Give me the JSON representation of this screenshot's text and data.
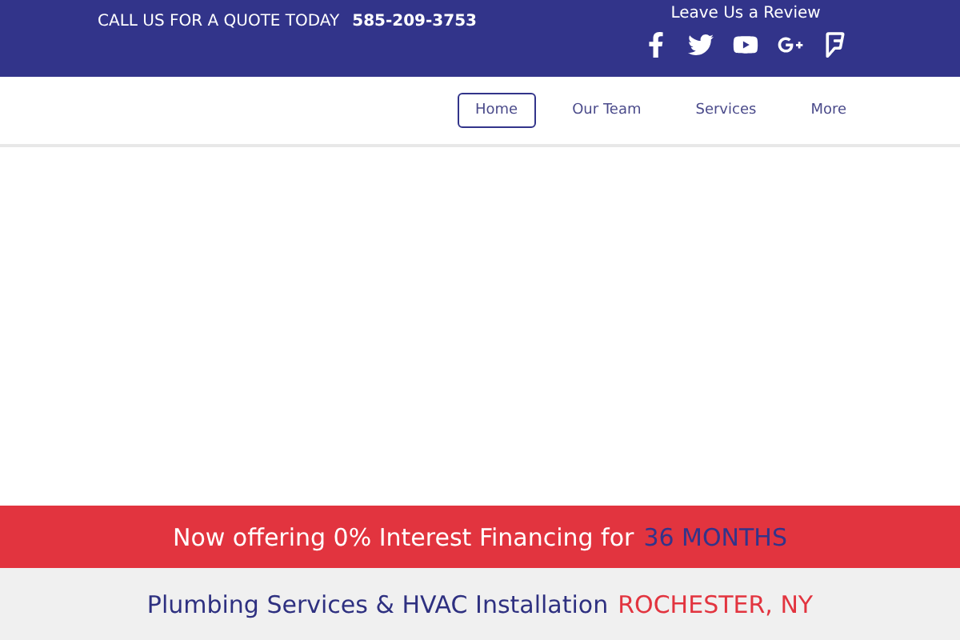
{
  "top_bar": {
    "call_label": "CALL US FOR A QUOTE TODAY",
    "phone": "585-209-3753",
    "review_label": "Leave Us a Review",
    "social": [
      {
        "kind": "facebook"
      },
      {
        "kind": "twitter"
      },
      {
        "kind": "youtube"
      },
      {
        "kind": "googleplus"
      },
      {
        "kind": "foursquare"
      }
    ]
  },
  "nav": [
    {
      "label": "Home",
      "selected": true
    },
    {
      "label": "Our Team",
      "selected": false
    },
    {
      "label": "Services",
      "selected": false
    },
    {
      "label": "More",
      "selected": false
    }
  ],
  "banner": {
    "text": "Now offering 0% Interest Financing for",
    "highlight": "36 MONTHS"
  },
  "tagline": {
    "text": "Plumbing Services & HVAC Installation",
    "location": "ROCHESTER, NY"
  }
}
